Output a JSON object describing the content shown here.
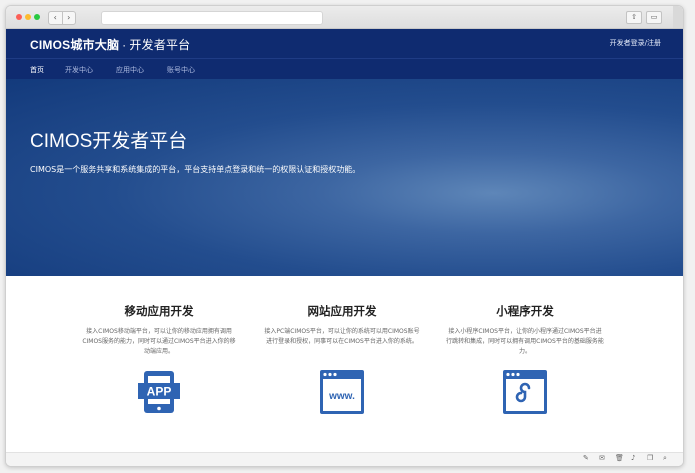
{
  "site": {
    "logo_brand": "CIMOS",
    "logo_cn": "城市大脑",
    "logo_sep": "·",
    "logo_sub": "开发者平台",
    "login_text": "开发者登录/注册"
  },
  "nav": {
    "items": [
      {
        "label": "首页",
        "active": true
      },
      {
        "label": "开发中心",
        "active": false
      },
      {
        "label": "应用中心",
        "active": false
      },
      {
        "label": "账号中心",
        "active": false
      }
    ]
  },
  "hero": {
    "title": "CIMOS开发者平台",
    "description": "CIMOS是一个服务共享和系统集成的平台，平台支持单点登录和统一的权限认证和授权功能。"
  },
  "features": [
    {
      "title": "移动应用开发",
      "description": "接入CIMOS移动端平台，可以让你的移动应用拥有调用CIMOS服务的能力，同时可以通过CIMOS平台进入你的移动端应用。",
      "icon": "app-icon",
      "icon_text": "APP"
    },
    {
      "title": "网站应用开发",
      "description": "接入PC端CIMOS平台，可以让你的系统可以用CIMOS账号进行登录和授权，同事可以在CIMOS平台进入你的系统。",
      "icon": "www-icon",
      "icon_text": "www."
    },
    {
      "title": "小程序开发",
      "description": "接入小程序CIMOS平台，让你的小程序通过CIMOS平台进行跳转和集成，同时可以拥有调用CIMOS平台的基础服务能力。",
      "icon": "mini-program-icon",
      "icon_text": ""
    }
  ],
  "colors": {
    "navy": "#0f2b70",
    "icon_blue": "#2f64b3"
  }
}
